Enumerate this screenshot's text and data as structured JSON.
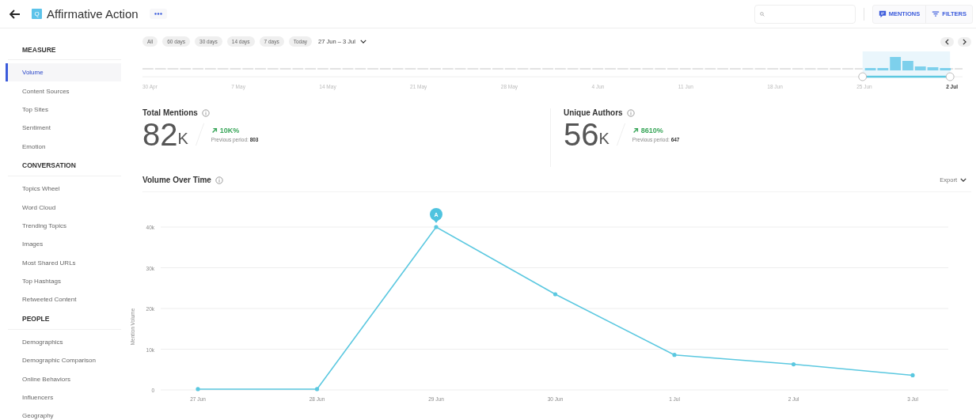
{
  "header": {
    "title": "Affirmative Action",
    "logo_letter": "Q",
    "buttons": [
      {
        "kind": "mentions",
        "label": "MENTIONS"
      },
      {
        "kind": "filters",
        "label": "FILTERS"
      }
    ]
  },
  "sidebar": {
    "sections": [
      {
        "title": "MEASURE",
        "items": [
          {
            "label": "Volume",
            "selected": true
          },
          {
            "label": "Content Sources",
            "selected": false
          },
          {
            "label": "Top Sites",
            "selected": false
          },
          {
            "label": "Sentiment",
            "selected": false
          },
          {
            "label": "Emotion",
            "selected": false
          }
        ]
      },
      {
        "title": "CONVERSATION",
        "items": [
          {
            "label": "Topics Wheel",
            "selected": false
          },
          {
            "label": "Word Cloud",
            "selected": false
          },
          {
            "label": "Trending Topics",
            "selected": false
          },
          {
            "label": "Images",
            "selected": false
          },
          {
            "label": "Most Shared URLs",
            "selected": false
          },
          {
            "label": "Top Hashtags",
            "selected": false
          },
          {
            "label": "Retweeted Content",
            "selected": false
          }
        ]
      },
      {
        "title": "PEOPLE",
        "items": [
          {
            "label": "Demographics",
            "selected": false
          },
          {
            "label": "Demographic Comparison",
            "selected": false
          },
          {
            "label": "Online Behaviors",
            "selected": false
          },
          {
            "label": "Influencers",
            "selected": false
          },
          {
            "label": "Geography",
            "selected": false
          }
        ]
      }
    ]
  },
  "date_filter": {
    "presets": [
      {
        "label": "All",
        "selected": false
      },
      {
        "label": "60 days",
        "selected": false
      },
      {
        "label": "30 days",
        "selected": false
      },
      {
        "label": "14 days",
        "selected": false
      },
      {
        "label": "7 days",
        "selected": false
      },
      {
        "label": "Today",
        "selected": false
      }
    ],
    "range": "27 Jun – 3 Jul"
  },
  "timeline": {
    "labels": [
      {
        "label": "30 Apr",
        "selected": false
      },
      {
        "label": "7 May",
        "selected": false
      },
      {
        "label": "14 May",
        "selected": false
      },
      {
        "label": "21 May",
        "selected": false
      },
      {
        "label": "28 May",
        "selected": false
      },
      {
        "label": "4 Jun",
        "selected": false
      },
      {
        "label": "11 Jun",
        "selected": false
      },
      {
        "label": "18 Jun",
        "selected": false
      },
      {
        "label": "25 Jun",
        "selected": false
      },
      {
        "label": "2 Jul",
        "selected": true
      }
    ]
  },
  "metrics": [
    {
      "title": "Total Mentions",
      "value": "82",
      "unit": "K",
      "change": "10K%",
      "previous": "Previous period: **803**"
    },
    {
      "title": "Unique Authors",
      "value": "56",
      "unit": "K",
      "change": "8610%",
      "previous": "Previous period: **647**"
    }
  ],
  "volume_over_time": {
    "title": "Volume Over Time",
    "export": "Export",
    "chart_data": {
      "type": "line",
      "ylabel": "Mention Volume",
      "categories": [
        "27 Jun",
        "28 Jun",
        "29 Jun",
        "30 Jun",
        "1 Jul",
        "2 Jul",
        "3 Jul"
      ],
      "grid": true,
      "series": [
        {
          "color": "#5bc8e0",
          "values": [
            200,
            200,
            40000,
            23500,
            8600,
            6300,
            3600
          ]
        }
      ],
      "ylim": [
        0,
        40000
      ],
      "yticks": [
        {
          "value": 0,
          "label": "0"
        },
        {
          "value": 10000,
          "label": "10k"
        },
        {
          "value": 20000,
          "label": "20k"
        },
        {
          "value": 30000,
          "label": "30k"
        },
        {
          "value": 40000,
          "label": "40k"
        }
      ],
      "annotations": [
        "A"
      ]
    }
  }
}
